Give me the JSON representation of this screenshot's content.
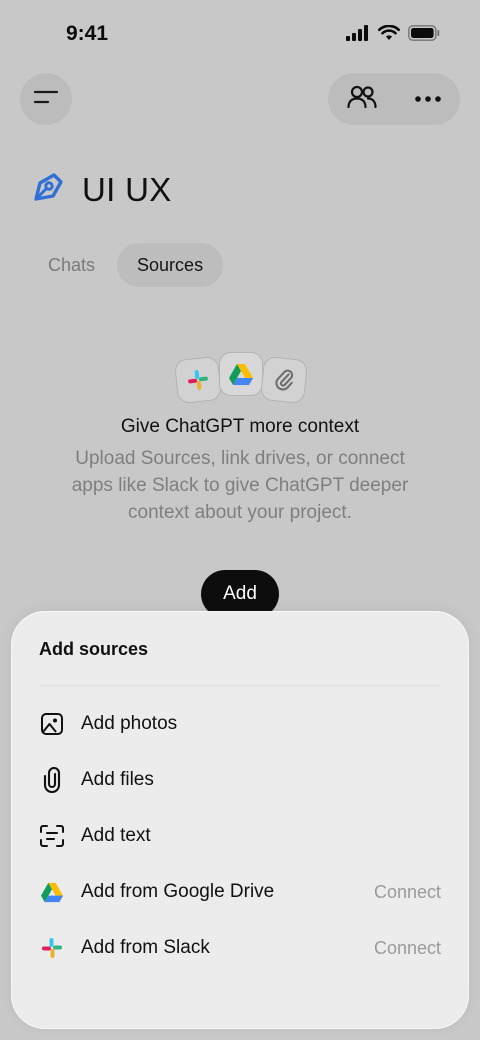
{
  "status_bar": {
    "time": "9:41"
  },
  "header": {
    "menu_icon": "menu-icon",
    "people_icon": "people-icon",
    "more_icon": "more-dots-icon"
  },
  "project": {
    "icon": "pen-nib-icon",
    "title": "UI UX",
    "accent_color": "#2f6fd6"
  },
  "tabs": [
    {
      "label": "Chats",
      "active": false
    },
    {
      "label": "Sources",
      "active": true
    }
  ],
  "empty_state": {
    "icons": [
      "slack-icon",
      "google-drive-icon",
      "paperclip-icon"
    ],
    "title": "Give ChatGPT more context",
    "description": "Upload Sources, link drives, or connect apps like Slack to give ChatGPT deeper context about your project.",
    "add_label": "Add"
  },
  "sheet": {
    "title": "Add sources",
    "items": [
      {
        "label": "Add photos",
        "icon": "photo-icon",
        "action": ""
      },
      {
        "label": "Add files",
        "icon": "paperclip-icon",
        "action": ""
      },
      {
        "label": "Add text",
        "icon": "text-scan-icon",
        "action": ""
      },
      {
        "label": "Add from Google Drive",
        "icon": "google-drive-icon",
        "action": "Connect"
      },
      {
        "label": "Add from Slack",
        "icon": "slack-icon",
        "action": "Connect"
      }
    ]
  }
}
